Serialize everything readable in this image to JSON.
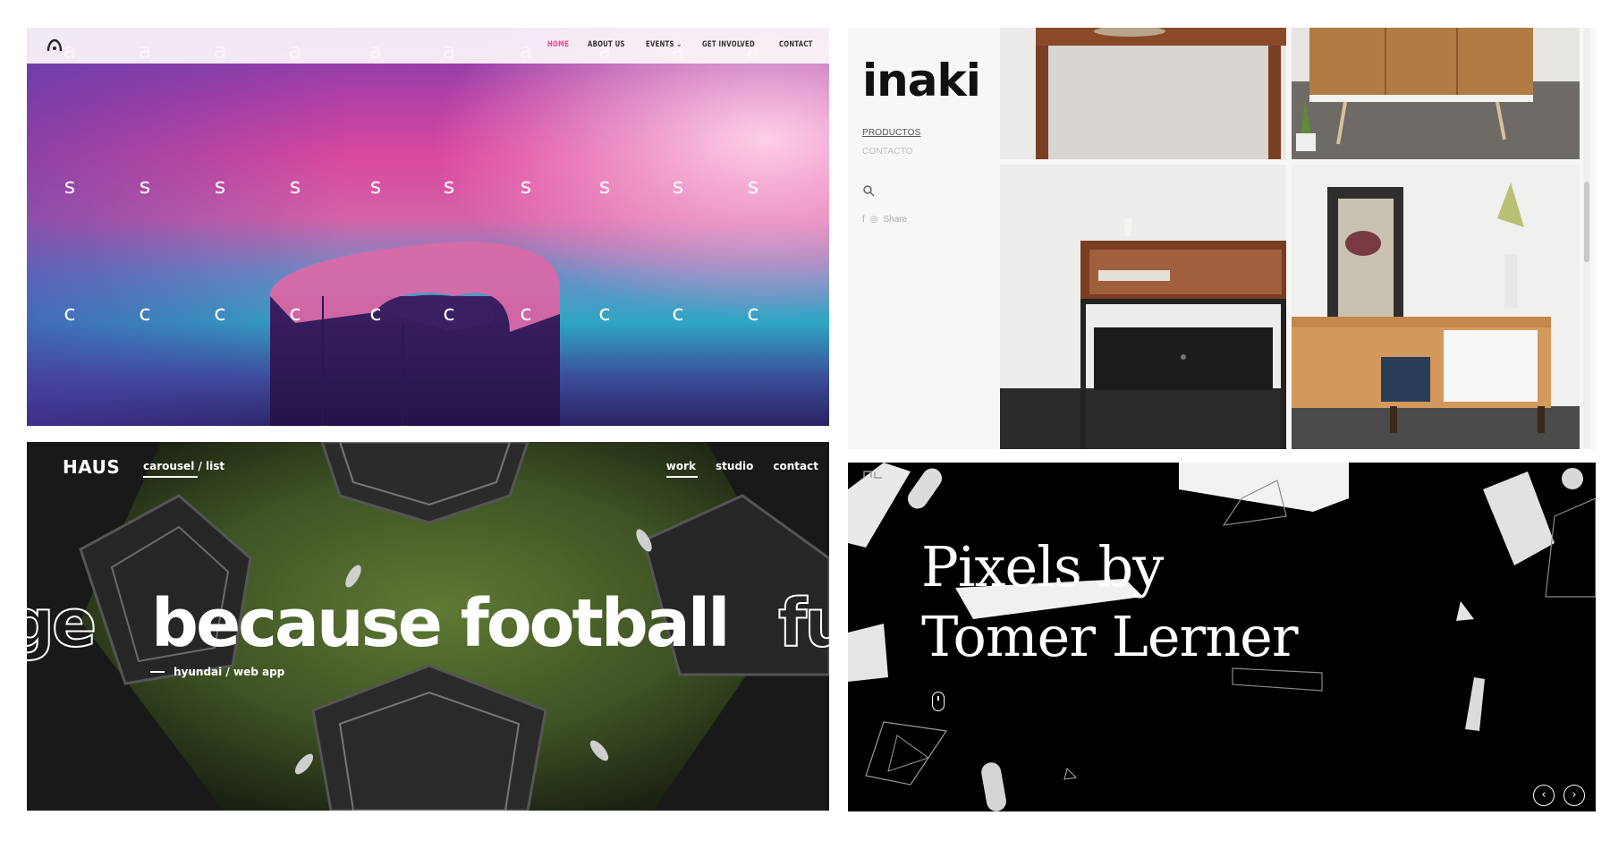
{
  "panel_asc": {
    "nav": {
      "home": "HOME",
      "about": "ABOUT US",
      "events": "EVENTS",
      "get_involved": "GET INVOLVED",
      "contact": "CONTACT"
    },
    "glyph_rows": [
      "a",
      "s",
      "c"
    ],
    "colors": {
      "accent": "#e5468f"
    },
    "icons": {
      "logo": "arch-logo-icon",
      "events_dropdown": "chevron-down-icon"
    }
  },
  "panel_inaki": {
    "brand": "inaki",
    "nav": {
      "products": "PRODUCTOS",
      "contact": "CONTACTO"
    },
    "social": {
      "share_label": "Share"
    },
    "icons": {
      "search": "search-icon",
      "facebook": "facebook-icon",
      "instagram": "instagram-icon"
    }
  },
  "panel_haus": {
    "brand": "HAUS",
    "view_toggle": "carousel / list",
    "nav": {
      "work": "work",
      "studio": "studio",
      "contact": "contact"
    },
    "headline": "because football",
    "ghost_left": "ge",
    "ghost_right": "fu",
    "subline": "hyundai / web app"
  },
  "panel_pixels": {
    "title_line1": "Pixels by",
    "title_line2": "Tomer Lerner",
    "icons": {
      "scroll": "mouse-scroll-icon",
      "prev": "chevron-left-icon",
      "next": "chevron-right-icon"
    },
    "prev_glyph": "‹",
    "next_glyph": "›"
  }
}
